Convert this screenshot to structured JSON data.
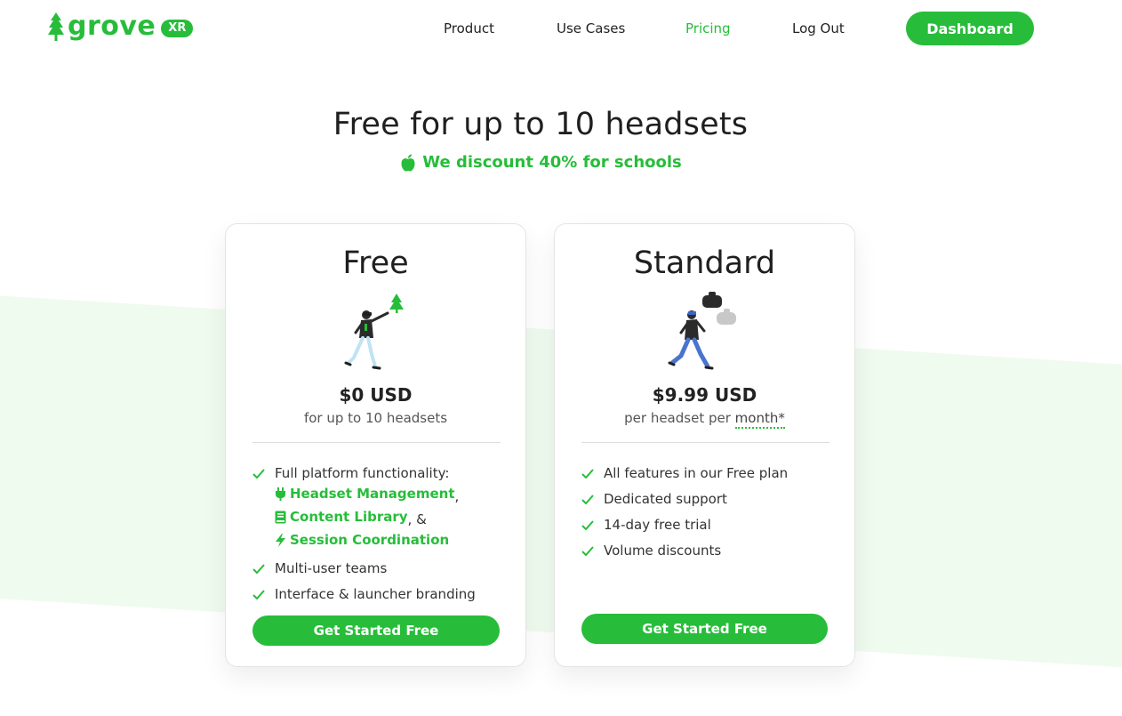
{
  "header": {
    "logo_text": "grove",
    "logo_badge": "XR",
    "nav": [
      {
        "label": "Product",
        "active": false
      },
      {
        "label": "Use Cases",
        "active": false
      },
      {
        "label": "Pricing",
        "active": true
      },
      {
        "label": "Log Out",
        "active": false
      }
    ],
    "dashboard_label": "Dashboard"
  },
  "hero": {
    "title": "Free for up to 10 headsets",
    "subtitle": "We discount 40% for schools",
    "subtitle_icon": "apple-icon"
  },
  "plans": [
    {
      "name": "Free",
      "price": "$0 USD",
      "price_sub": "for up to 10 headsets",
      "features": {
        "intro": "Full platform functionality:",
        "links": [
          {
            "icon": "plug-icon",
            "label": "Headset Management",
            "suffix": ","
          },
          {
            "icon": "book-icon",
            "label": "Content Library",
            "suffix": ", &"
          },
          {
            "icon": "bolt-icon",
            "label": "Session Coordination",
            "suffix": ""
          }
        ],
        "items": [
          "Multi-user teams",
          "Interface & launcher branding"
        ]
      },
      "cta": "Get Started Free"
    },
    {
      "name": "Standard",
      "price": "$9.99 USD",
      "price_sub_prefix": "per headset per ",
      "price_sub_term": "month*",
      "features": {
        "items": [
          "All features in our Free plan",
          "Dedicated support",
          "14-day free trial",
          "Volume discounts"
        ]
      },
      "cta": "Get Started Free"
    }
  ],
  "colors": {
    "accent": "#27bd3a",
    "band": "#effbee",
    "text": "#222222"
  }
}
